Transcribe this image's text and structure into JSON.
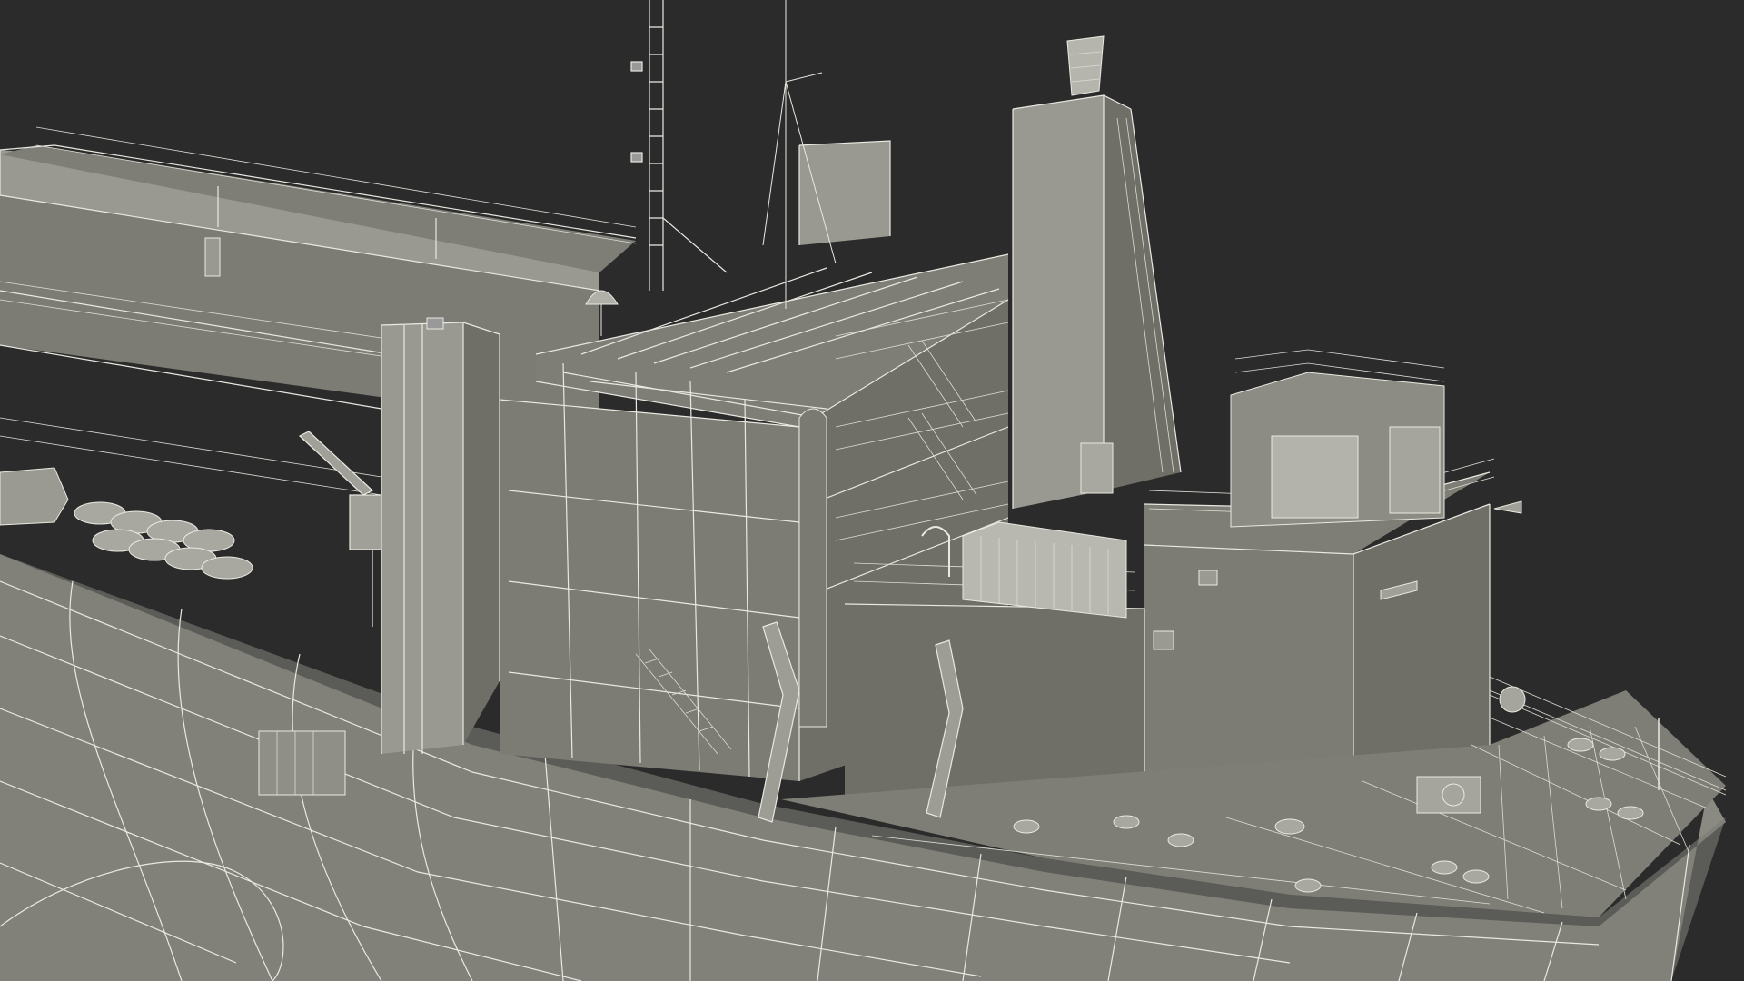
{
  "scene": {
    "subject": "ship-wireframe-render",
    "colors": {
      "background": "#2b2b2b",
      "hull": "#8a8a82",
      "wire": "#e9e9e2"
    }
  }
}
